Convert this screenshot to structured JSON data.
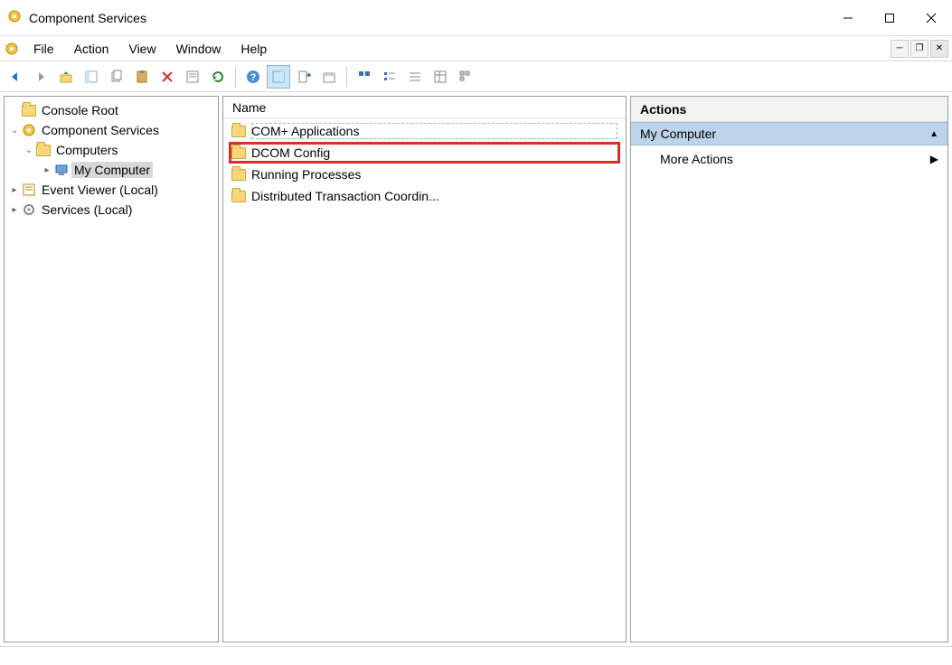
{
  "window": {
    "title": "Component Services"
  },
  "menu": {
    "items": [
      "File",
      "Action",
      "View",
      "Window",
      "Help"
    ]
  },
  "toolbar": {
    "buttons": [
      "back",
      "forward",
      "up-folder",
      "show-hide-tree",
      "copy",
      "paste",
      "delete",
      "properties",
      "refresh",
      "help",
      "show-hide-action",
      "export-list",
      "new-window",
      "sep",
      "view-list-1",
      "view-list-2",
      "view-list-3",
      "view-detail",
      "view-tiles"
    ]
  },
  "tree": {
    "root": {
      "label": "Console Root",
      "expanded": true
    },
    "nodes": [
      {
        "label": "Component Services",
        "expanded": true,
        "icon": "gear",
        "children": [
          {
            "label": "Computers",
            "expanded": true,
            "icon": "folder",
            "children": [
              {
                "label": "My Computer",
                "icon": "computer",
                "selected": true,
                "hasChildren": true
              }
            ]
          }
        ]
      },
      {
        "label": "Event Viewer (Local)",
        "icon": "eventviewer",
        "hasChildren": true
      },
      {
        "label": "Services (Local)",
        "icon": "services",
        "hasChildren": true
      }
    ]
  },
  "list": {
    "header": "Name",
    "items": [
      {
        "label": "COM+ Applications",
        "selected": true
      },
      {
        "label": "DCOM Config",
        "highlighted": true
      },
      {
        "label": "Running Processes"
      },
      {
        "label": "Distributed Transaction Coordin..."
      }
    ]
  },
  "actions": {
    "title": "Actions",
    "context": "My Computer",
    "items": [
      {
        "label": "More Actions",
        "hasSubmenu": true
      }
    ]
  }
}
